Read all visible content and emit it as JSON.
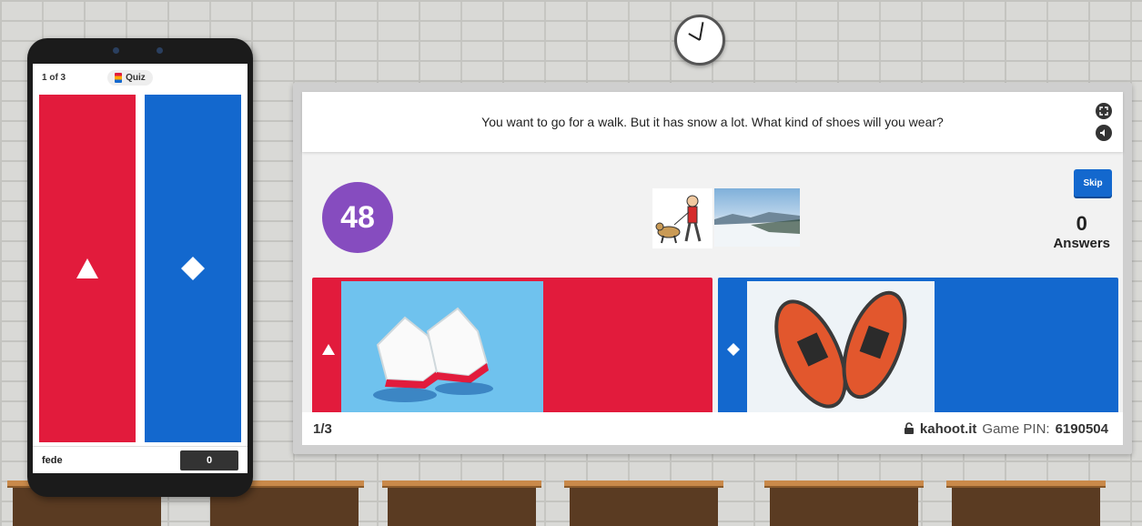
{
  "colors": {
    "red": "#e21b3c",
    "blue": "#1368ce",
    "purple": "#864cbf",
    "sky": "#6fc2ee"
  },
  "phone": {
    "question_counter": "1 of 3",
    "mode_label": "Quiz",
    "answers": [
      {
        "shape": "triangle-icon",
        "color": "red"
      },
      {
        "shape": "diamond-icon",
        "color": "blue"
      }
    ],
    "player_name": "fede",
    "score": "0"
  },
  "board": {
    "question": "You want to go for a walk. But it has snow a lot. What kind of shoes will you wear?",
    "timer": "48",
    "skip_label": "Skip",
    "answers_count": "0",
    "answers_label": "Answers",
    "answers": [
      {
        "shape": "triangle-icon",
        "color": "red",
        "image": "sneakers"
      },
      {
        "shape": "diamond-icon",
        "color": "blue",
        "image": "snowshoes"
      }
    ],
    "footer": {
      "progress": "1/3",
      "site": "kahoot.it",
      "pin_label": "Game PIN:",
      "pin": "6190504"
    }
  },
  "icons": [
    "fullscreen-icon",
    "volume-icon",
    "lock-icon",
    "clock-icon"
  ]
}
